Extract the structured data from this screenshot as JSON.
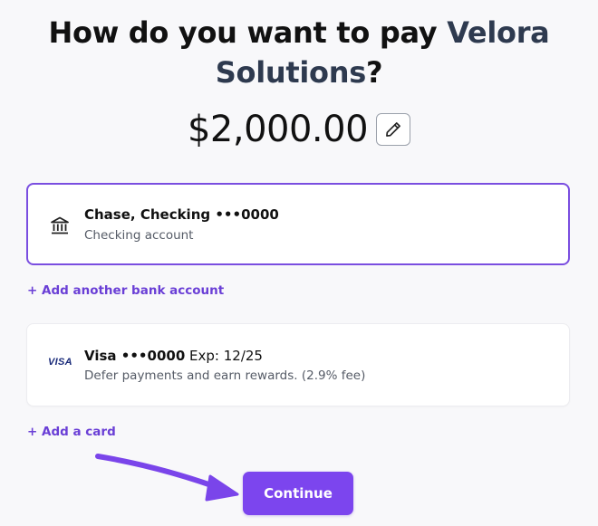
{
  "heading": {
    "prefix": "How do you want to pay ",
    "payee": "Velora Solutions",
    "suffix": "?"
  },
  "amount": {
    "value": "$2,000.00",
    "edit_icon": "pencil-icon"
  },
  "bank_account": {
    "icon": "bank-icon",
    "title": "Chase, Checking •••0000",
    "subtitle": "Checking account",
    "selected": true
  },
  "add_bank_link": "+ Add another bank account",
  "card": {
    "icon_text": "VISA",
    "title": "Visa •••0000",
    "expiry": " Exp: 12/25",
    "subtitle": "Defer payments and earn rewards. (2.9% fee)"
  },
  "add_card_link": "+ Add a card",
  "continue_label": "Continue",
  "colors": {
    "accent": "#7c45ee",
    "selected_border": "#7a4ee0",
    "link": "#6a3fd6",
    "payee": "#2e3a4f"
  }
}
